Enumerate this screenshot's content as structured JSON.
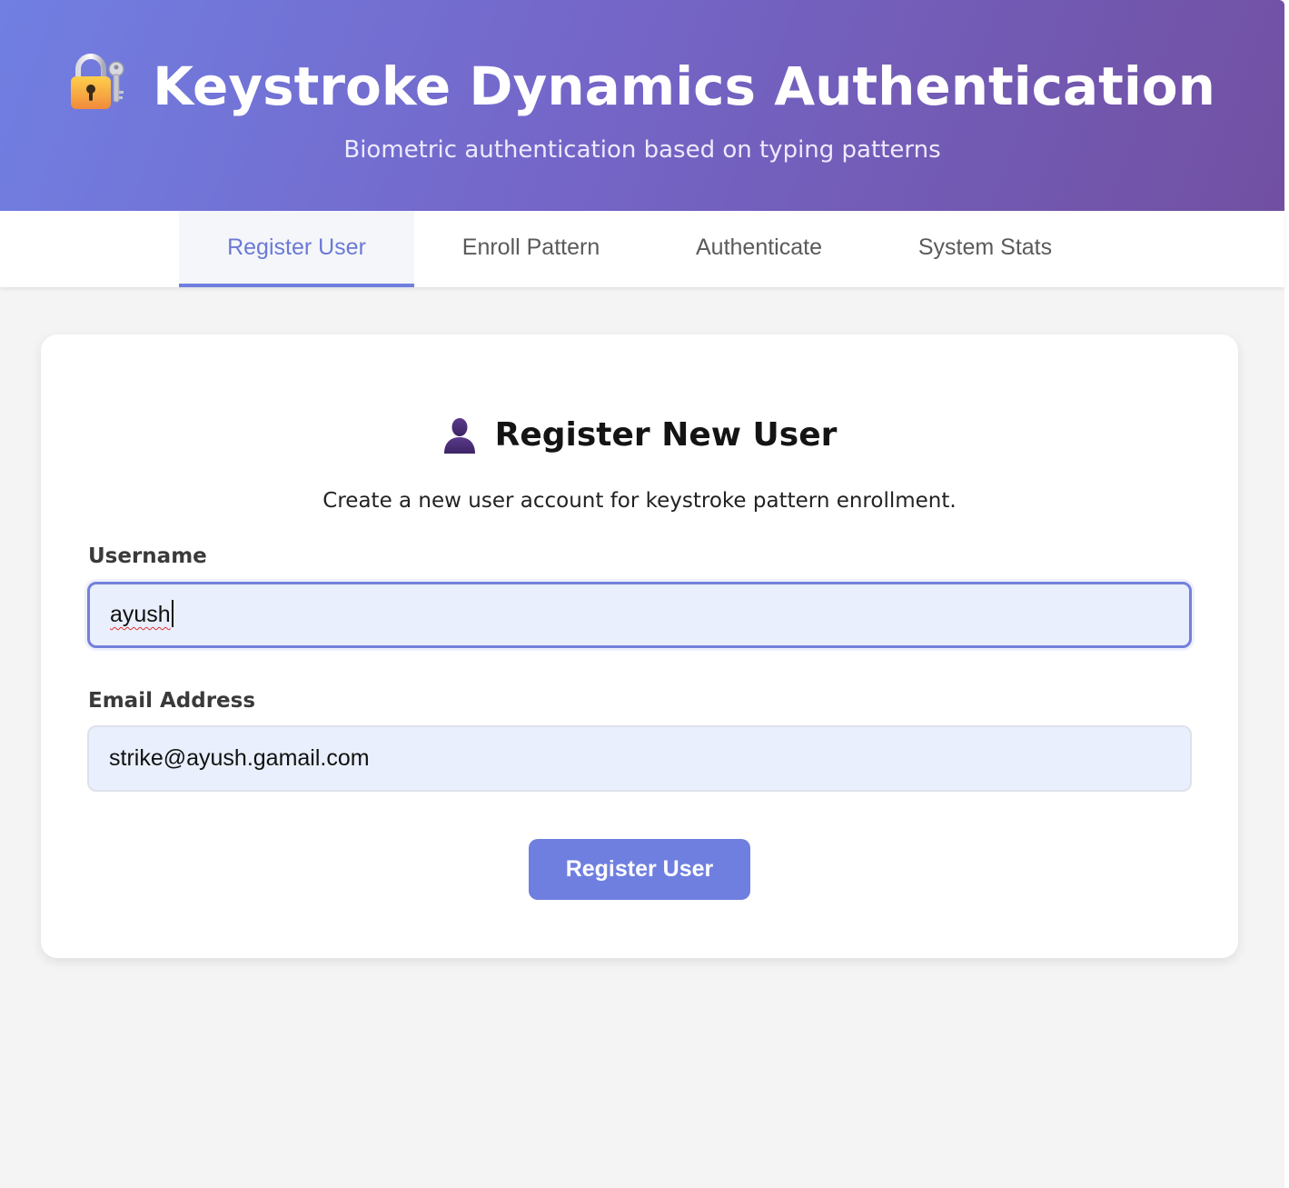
{
  "header": {
    "title": "Keystroke Dynamics Authentication",
    "subtitle": "Biometric authentication based on typing patterns",
    "icon": "lock-with-key-icon"
  },
  "tabs": [
    {
      "label": "Register User",
      "active": true
    },
    {
      "label": "Enroll Pattern",
      "active": false
    },
    {
      "label": "Authenticate",
      "active": false
    },
    {
      "label": "System Stats",
      "active": false
    }
  ],
  "card": {
    "icon": "user-silhouette-icon",
    "title": "Register New User",
    "description": "Create a new user account for keystroke pattern enrollment.",
    "username": {
      "label": "Username",
      "value": "ayush",
      "focused": true
    },
    "email": {
      "label": "Email Address",
      "value": "strike@ayush.gamail.com"
    },
    "submit_label": "Register User"
  },
  "colors": {
    "header_gradient_start": "#717fe2",
    "header_gradient_end": "#7150a2",
    "accent": "#6f7fe0",
    "page_background": "#f4f4f4",
    "input_background": "#e9effc"
  }
}
